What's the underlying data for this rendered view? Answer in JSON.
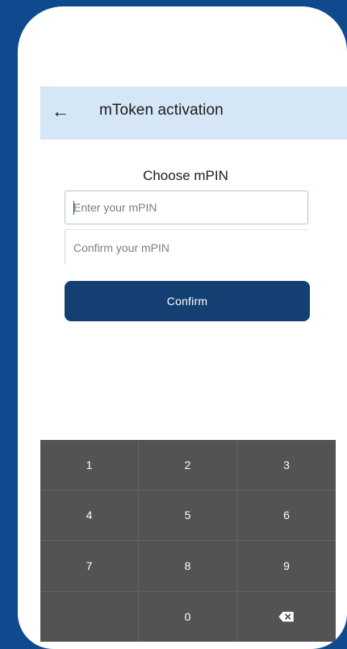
{
  "app_bar": {
    "back_icon": "arrow-left-icon",
    "title": "mToken activation"
  },
  "form": {
    "title": "Choose mPIN",
    "pin_placeholder": "Enter your mPIN",
    "pin_value": "",
    "confirm_placeholder": "Confirm your mPIN",
    "confirm_value": "",
    "button_label": "Confirm"
  },
  "keypad": {
    "keys": [
      {
        "label": "1"
      },
      {
        "label": "2"
      },
      {
        "label": "3"
      },
      {
        "label": "4"
      },
      {
        "label": "5"
      },
      {
        "label": "6"
      },
      {
        "label": "7"
      },
      {
        "label": "8"
      },
      {
        "label": "9"
      },
      {
        "label": ""
      },
      {
        "label": "0"
      },
      {
        "icon": "backspace-icon"
      }
    ]
  },
  "colors": {
    "background": "#0f4a8e",
    "app_bar": "#d5e6f6",
    "primary_button": "#133f72",
    "keypad": "#535353"
  }
}
